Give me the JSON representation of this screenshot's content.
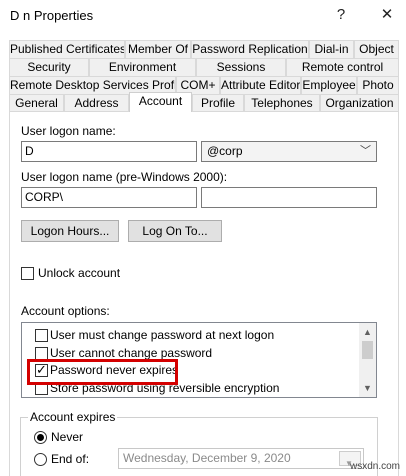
{
  "window": {
    "title": "D                  n Properties",
    "help_label": "?",
    "close_label": "✕"
  },
  "tabs": {
    "row1": [
      "Published Certificates",
      "Member Of",
      "Password Replication",
      "Dial-in",
      "Object"
    ],
    "row2": [
      "Security",
      "Environment",
      "Sessions",
      "Remote control"
    ],
    "row3": [
      "Remote Desktop Services Profile",
      "COM+",
      "Attribute Editor",
      "Employee",
      "Photo"
    ],
    "row4": [
      "General",
      "Address",
      "Account",
      "Profile",
      "Telephones",
      "Organization"
    ],
    "active": "Account"
  },
  "account": {
    "logon_name_label": "User logon name:",
    "logon_name_value": "D",
    "upn_suffix_value": "@corp",
    "pre2000_label": "User logon name (pre-Windows 2000):",
    "pre2000_domain": "CORP\\",
    "pre2000_name": "",
    "logon_hours_label": "Logon Hours...",
    "logon_to_label": "Log On To...",
    "unlock_label": "Unlock account",
    "unlock_checked": false,
    "options_label": "Account options:",
    "options": [
      {
        "label": "User must change password at next logon",
        "checked": false
      },
      {
        "label": "User cannot change password",
        "checked": false
      },
      {
        "label": "Password never expires",
        "checked": true
      },
      {
        "label": "Store password using reversible encryption",
        "checked": false
      }
    ],
    "expires_label": "Account expires",
    "expires_never_label": "Never",
    "expires_never_selected": true,
    "expires_endof_label": "End of:",
    "expires_date": "Wednesday,  December   9, 2020"
  },
  "icons": {
    "dropdown": "chevron-down-icon",
    "calendar": "calendar-icon"
  },
  "colors": {
    "highlight": "#d40000"
  },
  "watermark": "wsxdn.com"
}
